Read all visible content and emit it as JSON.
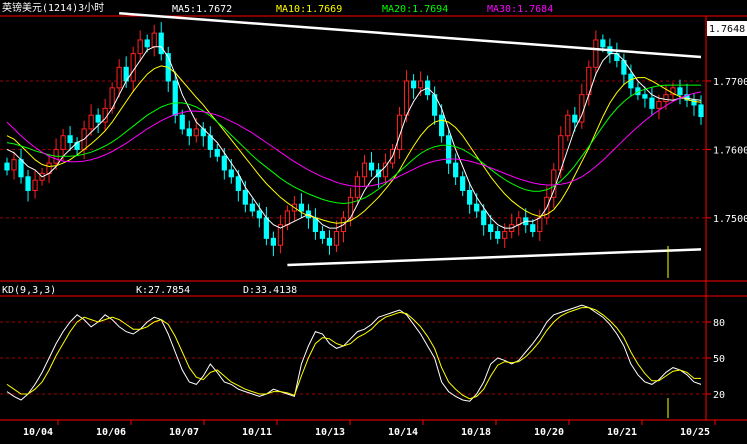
{
  "header": {
    "title": "英镑美元(1214)3小时",
    "ma5_label": "MA5:1.7672",
    "ma10_label": "MA10:1.7669",
    "ma20_label": "MA20:1.7694",
    "ma30_label": "MA30:1.7684"
  },
  "kd_header": {
    "name": "KD(9,3,3)",
    "k_label": "K:27.7854",
    "d_label": "D:33.4138"
  },
  "colors": {
    "background": "#000000",
    "up_candle": "#ff2020",
    "down_candle": "#00ffff",
    "ma5": "#ffffff",
    "ma10": "#ffff00",
    "ma20": "#00ff00",
    "ma30": "#ff00ff",
    "grid": "#a00000",
    "frame": "#ff0000",
    "axis_text": "#ffffff",
    "trendline": "#ffffff",
    "k_line": "#ffffff",
    "d_line": "#ffff00",
    "price_tag_bg": "#ffffff",
    "price_tag_text": "#000000"
  },
  "chart_data": [
    {
      "type": "candlestick",
      "title": "英镑美元(1214)3小时",
      "y_ticks": [
        "1.7700",
        "1.7600",
        "1.7500"
      ],
      "current_price_label": "1.7648",
      "x_ticks": [
        "10/04",
        "10/06",
        "10/07",
        "10/11",
        "10/13",
        "10/14",
        "10/18",
        "10/20",
        "10/21",
        "10/25"
      ],
      "ylim": [
        1.7415,
        1.7795
      ],
      "close": [
        1.757,
        1.7585,
        1.756,
        1.754,
        1.7555,
        1.7565,
        1.758,
        1.76,
        1.762,
        1.761,
        1.76,
        1.763,
        1.765,
        1.764,
        1.766,
        1.769,
        1.772,
        1.77,
        1.774,
        1.776,
        1.775,
        1.777,
        1.774,
        1.77,
        1.765,
        1.763,
        1.762,
        1.763,
        1.762,
        1.76,
        1.759,
        1.757,
        1.756,
        1.754,
        1.752,
        1.751,
        1.75,
        1.747,
        1.746,
        1.749,
        1.751,
        1.752,
        1.751,
        1.75,
        1.748,
        1.747,
        1.746,
        1.748,
        1.75,
        1.753,
        1.756,
        1.758,
        1.757,
        1.756,
        1.758,
        1.76,
        1.765,
        1.77,
        1.769,
        1.77,
        1.768,
        1.765,
        1.762,
        1.758,
        1.756,
        1.754,
        1.752,
        1.751,
        1.749,
        1.748,
        1.747,
        1.748,
        1.749,
        1.75,
        1.749,
        1.748,
        1.75,
        1.753,
        1.757,
        1.762,
        1.765,
        1.764,
        1.768,
        1.772,
        1.776,
        1.775,
        1.774,
        1.773,
        1.771,
        1.769,
        1.768,
        1.7675,
        1.766,
        1.767,
        1.768,
        1.769,
        1.768,
        1.7672,
        1.7665,
        1.7648
      ],
      "ma5": [
        1.76,
        1.7595,
        1.7585,
        1.7575,
        1.757,
        1.756,
        1.7565,
        1.7575,
        1.759,
        1.76,
        1.761,
        1.7615,
        1.7625,
        1.7635,
        1.7645,
        1.766,
        1.768,
        1.77,
        1.7715,
        1.773,
        1.7745,
        1.775,
        1.775,
        1.7735,
        1.771,
        1.768,
        1.766,
        1.764,
        1.763,
        1.762,
        1.761,
        1.7595,
        1.758,
        1.7565,
        1.7545,
        1.753,
        1.7515,
        1.75,
        1.749,
        1.7485,
        1.749,
        1.7495,
        1.75,
        1.7505,
        1.75,
        1.749,
        1.7485,
        1.7485,
        1.749,
        1.75,
        1.752,
        1.754,
        1.7555,
        1.7565,
        1.7575,
        1.759,
        1.762,
        1.765,
        1.767,
        1.7685,
        1.769,
        1.768,
        1.766,
        1.763,
        1.76,
        1.7575,
        1.755,
        1.753,
        1.7515,
        1.75,
        1.749,
        1.7485,
        1.7485,
        1.749,
        1.7495,
        1.7495,
        1.75,
        1.7515,
        1.754,
        1.757,
        1.76,
        1.763,
        1.765,
        1.768,
        1.771,
        1.773,
        1.774,
        1.774,
        1.773,
        1.7715,
        1.77,
        1.769,
        1.768,
        1.7675,
        1.7673,
        1.7672,
        1.7675,
        1.7675,
        1.7673,
        1.7672
      ],
      "ma10": [
        1.762,
        1.7615,
        1.7605,
        1.7595,
        1.7585,
        1.7578,
        1.7575,
        1.7576,
        1.758,
        1.7585,
        1.7592,
        1.76,
        1.7608,
        1.7617,
        1.7627,
        1.764,
        1.7655,
        1.767,
        1.7685,
        1.7698,
        1.771,
        1.7718,
        1.7722,
        1.772,
        1.7712,
        1.77,
        1.7688,
        1.7676,
        1.7665,
        1.7652,
        1.764,
        1.7627,
        1.7614,
        1.7601,
        1.7588,
        1.7575,
        1.7562,
        1.755,
        1.754,
        1.753,
        1.7522,
        1.7515,
        1.7508,
        1.7503,
        1.75,
        1.7497,
        1.7494,
        1.7492,
        1.7493,
        1.7496,
        1.7502,
        1.751,
        1.752,
        1.753,
        1.7542,
        1.7555,
        1.757,
        1.7588,
        1.7605,
        1.762,
        1.7632,
        1.764,
        1.7643,
        1.764,
        1.7632,
        1.762,
        1.7605,
        1.759,
        1.7575,
        1.756,
        1.7547,
        1.7535,
        1.7525,
        1.7517,
        1.751,
        1.7505,
        1.7502,
        1.7505,
        1.7512,
        1.7525,
        1.7542,
        1.7562,
        1.7582,
        1.7602,
        1.7625,
        1.7648,
        1.7668,
        1.7683,
        1.7695,
        1.7702,
        1.7705,
        1.7705,
        1.77,
        1.7694,
        1.7688,
        1.7682,
        1.7677,
        1.7673,
        1.767,
        1.7669
      ],
      "ma20": [
        1.761,
        1.7608,
        1.7605,
        1.7602,
        1.7598,
        1.7595,
        1.7592,
        1.759,
        1.759,
        1.759,
        1.7591,
        1.7593,
        1.7596,
        1.76,
        1.7605,
        1.7611,
        1.7618,
        1.7626,
        1.7634,
        1.7642,
        1.765,
        1.7656,
        1.7662,
        1.7666,
        1.7668,
        1.7668,
        1.7666,
        1.7662,
        1.7656,
        1.7649,
        1.764,
        1.7631,
        1.7621,
        1.7611,
        1.7601,
        1.7591,
        1.7582,
        1.7574,
        1.7566,
        1.7558,
        1.7551,
        1.7545,
        1.754,
        1.7535,
        1.7531,
        1.7527,
        1.7524,
        1.7522,
        1.7521,
        1.7522,
        1.7525,
        1.7529,
        1.7535,
        1.7542,
        1.755,
        1.7559,
        1.7568,
        1.7577,
        1.7586,
        1.7594,
        1.76,
        1.7604,
        1.7606,
        1.7606,
        1.7604,
        1.76,
        1.7594,
        1.7587,
        1.7579,
        1.7571,
        1.7563,
        1.7556,
        1.755,
        1.7545,
        1.7541,
        1.7539,
        1.7539,
        1.7541,
        1.7546,
        1.7554,
        1.7564,
        1.7576,
        1.759,
        1.7604,
        1.7619,
        1.7634,
        1.7648,
        1.766,
        1.767,
        1.7678,
        1.7684,
        1.7688,
        1.7691,
        1.7693,
        1.7694,
        1.7694,
        1.7694,
        1.7694,
        1.7694,
        1.7694
      ],
      "ma30": [
        1.764,
        1.763,
        1.762,
        1.7611,
        1.7603,
        1.7596,
        1.759,
        1.7586,
        1.7583,
        1.7582,
        1.7582,
        1.7583,
        1.7585,
        1.7588,
        1.7592,
        1.7597,
        1.7603,
        1.7609,
        1.7616,
        1.7623,
        1.763,
        1.7636,
        1.7642,
        1.7647,
        1.7651,
        1.7654,
        1.7656,
        1.7656,
        1.7655,
        1.7653,
        1.765,
        1.7646,
        1.7641,
        1.7636,
        1.763,
        1.7624,
        1.7617,
        1.761,
        1.7603,
        1.7596,
        1.7589,
        1.7582,
        1.7576,
        1.757,
        1.7565,
        1.756,
        1.7556,
        1.7552,
        1.7549,
        1.7547,
        1.7546,
        1.7546,
        1.7547,
        1.7549,
        1.7552,
        1.7556,
        1.7561,
        1.7566,
        1.7571,
        1.7576,
        1.758,
        1.7583,
        1.7585,
        1.7586,
        1.7586,
        1.7585,
        1.7583,
        1.758,
        1.7577,
        1.7573,
        1.7569,
        1.7565,
        1.7561,
        1.7557,
        1.7554,
        1.7551,
        1.7549,
        1.7548,
        1.7548,
        1.7549,
        1.7551,
        1.7555,
        1.756,
        1.7567,
        1.7575,
        1.7584,
        1.7594,
        1.7604,
        1.7614,
        1.7624,
        1.7633,
        1.7642,
        1.765,
        1.7657,
        1.7664,
        1.767,
        1.7675,
        1.7679,
        1.7682,
        1.7684
      ],
      "trendlines": [
        {
          "from": [
            16,
            1.7799
          ],
          "to": [
            99,
            1.7735
          ]
        },
        {
          "from": [
            40,
            1.7431
          ],
          "to": [
            99,
            1.7454
          ]
        }
      ]
    },
    {
      "type": "line",
      "title": "KD(9,3,3)",
      "y_ticks": [
        "80",
        "50",
        "20"
      ],
      "ylim": [
        0,
        100
      ],
      "series": [
        {
          "name": "K",
          "values": [
            22,
            18,
            15,
            20,
            28,
            38,
            50,
            62,
            72,
            80,
            86,
            82,
            76,
            80,
            86,
            82,
            76,
            72,
            70,
            74,
            80,
            84,
            82,
            70,
            55,
            40,
            30,
            28,
            35,
            45,
            38,
            30,
            28,
            24,
            22,
            20,
            18,
            20,
            24,
            22,
            20,
            18,
            45,
            60,
            72,
            70,
            62,
            58,
            60,
            66,
            72,
            74,
            78,
            84,
            86,
            88,
            90,
            86,
            78,
            70,
            60,
            50,
            30,
            22,
            18,
            15,
            14,
            20,
            30,
            45,
            50,
            48,
            45,
            48,
            55,
            62,
            70,
            80,
            86,
            88,
            90,
            92,
            94,
            92,
            88,
            84,
            78,
            70,
            60,
            45,
            36,
            30,
            28,
            32,
            38,
            42,
            40,
            36,
            30,
            28
          ]
        },
        {
          "name": "D",
          "values": [
            28,
            24,
            20,
            20,
            24,
            30,
            40,
            52,
            62,
            72,
            80,
            84,
            82,
            80,
            82,
            84,
            82,
            78,
            74,
            74,
            76,
            80,
            82,
            78,
            68,
            55,
            42,
            34,
            32,
            38,
            40,
            35,
            30,
            27,
            24,
            22,
            20,
            20,
            22,
            22,
            21,
            19,
            35,
            50,
            62,
            67,
            66,
            62,
            60,
            62,
            67,
            70,
            74,
            80,
            84,
            86,
            88,
            87,
            82,
            76,
            68,
            58,
            42,
            30,
            24,
            19,
            16,
            18,
            24,
            35,
            44,
            47,
            46,
            47,
            51,
            57,
            64,
            73,
            80,
            85,
            88,
            90,
            92,
            92,
            90,
            86,
            81,
            75,
            67,
            55,
            45,
            37,
            31,
            31,
            35,
            39,
            40,
            38,
            33,
            33
          ]
        }
      ]
    }
  ]
}
